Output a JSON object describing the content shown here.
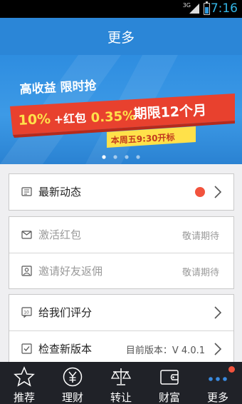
{
  "status_bar": {
    "network": "3G",
    "time": "7:16"
  },
  "header": {
    "title": "更多"
  },
  "banner": {
    "line1": "高收益  限时抢",
    "rate": "10%",
    "plus": "+红包",
    "bonus": "0.35%",
    "term": "期限12个月",
    "schedule": "本周五9:30开标",
    "page_indicator": {
      "count": 4,
      "active": 0
    }
  },
  "groups": [
    {
      "rows": [
        {
          "label": "最新动态",
          "has_new": true
        }
      ]
    },
    {
      "rows": [
        {
          "label": "激活红包",
          "hint": "敬请期待"
        },
        {
          "label": "邀请好友返佣",
          "hint": "敬请期待"
        }
      ]
    },
    {
      "rows": [
        {
          "label": "给我们评分"
        },
        {
          "label": "检查新版本",
          "version": "目前版本：V 4.0.1"
        }
      ]
    }
  ],
  "tabs": [
    {
      "label": "推荐",
      "icon": "star-icon"
    },
    {
      "label": "理财",
      "icon": "yen-coin-icon"
    },
    {
      "label": "转让",
      "icon": "scale-icon"
    },
    {
      "label": "财富",
      "icon": "wallet-icon"
    },
    {
      "label": "更多",
      "icon": "more-dots-icon",
      "active": true
    }
  ],
  "colors": {
    "header": "#2b86d7",
    "tabbar": "#202228",
    "accent_red": "#f2533d",
    "banner_ribbon": "#e8412e",
    "banner_yellow": "#ffe14a"
  }
}
